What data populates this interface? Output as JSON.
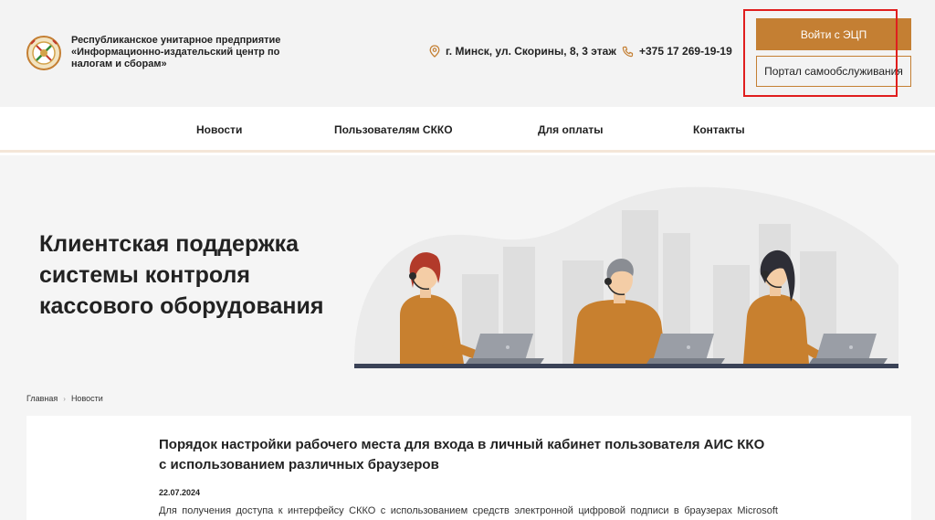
{
  "header": {
    "org_line1": "Республиканское унитарное предприятие",
    "org_line2": "«Информационно-издательский центр по",
    "org_line3": "налогам и сборам»",
    "address": "г. Минск, ул. Скорины, 8, 3 этаж",
    "phone": "+375 17 269-19-19",
    "login_button": "Войти с ЭЦП",
    "portal_button": "Портал самообслуживания"
  },
  "nav": {
    "items": [
      {
        "label": "Новости"
      },
      {
        "label": "Пользователям СККО"
      },
      {
        "label": "Для оплаты"
      },
      {
        "label": "Контакты"
      }
    ]
  },
  "hero": {
    "title_line1": "Клиентская поддержка",
    "title_line2": "системы контроля",
    "title_line3": "кассового оборудования"
  },
  "breadcrumb": {
    "home": "Главная",
    "current": "Новости"
  },
  "article": {
    "title_line1": "Порядок настройки рабочего места для входа в личный кабинет пользователя АИС ККО",
    "title_line2": "с использованием различных браузеров",
    "date": "22.07.2024",
    "text": "Для получения доступа к интерфейсу СККО с использованием средств электронной цифровой подписи в браузерах Microsoft"
  },
  "colors": {
    "accent": "#c47f33",
    "highlight": "#e01e1e",
    "header_bg": "#f3f3f3",
    "hero_bg": "#f5f5f5"
  },
  "icons": {
    "logo": "emblem-logo",
    "address": "location-pin-icon",
    "phone": "phone-icon",
    "breadcrumb_separator": "chevron-right-icon"
  }
}
